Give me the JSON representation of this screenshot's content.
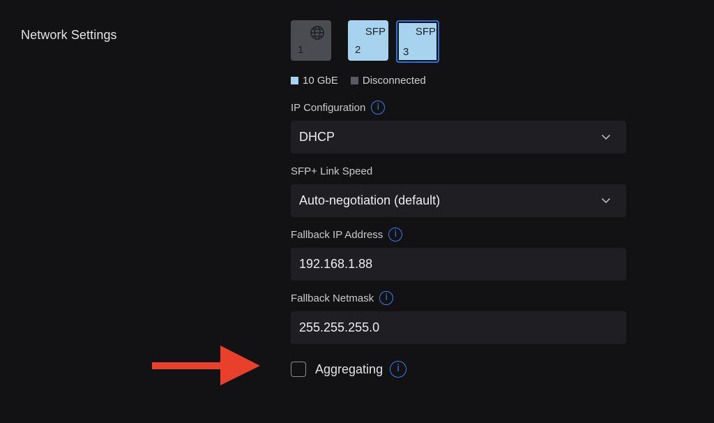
{
  "section": {
    "title": "Network Settings"
  },
  "ports": [
    {
      "number": "1",
      "tag": "",
      "icon": "globe-icon",
      "state": "disconnected"
    },
    {
      "number": "2",
      "tag": "SFP",
      "state": "10 GbE"
    },
    {
      "number": "3",
      "tag": "SFP",
      "state": "10 GbE",
      "selected": true
    }
  ],
  "legend": {
    "items": [
      {
        "label": "10 GbE",
        "color": "#a7d3ef"
      },
      {
        "label": "Disconnected",
        "color": "#5a5b60"
      }
    ]
  },
  "fields": {
    "ip_config": {
      "label": "IP Configuration",
      "value": "DHCP"
    },
    "sfp_speed": {
      "label": "SFP+ Link Speed",
      "value": "Auto-negotiation (default)"
    },
    "fallback_ip": {
      "label": "Fallback IP Address",
      "value": "192.168.1.88"
    },
    "fallback_netmask": {
      "label": "Fallback Netmask",
      "value": "255.255.255.0"
    },
    "aggregating": {
      "label": "Aggregating",
      "checked": false
    }
  },
  "colors": {
    "accent": "#3d7ee6",
    "arrow": "#e8402a",
    "background": "#121214"
  }
}
